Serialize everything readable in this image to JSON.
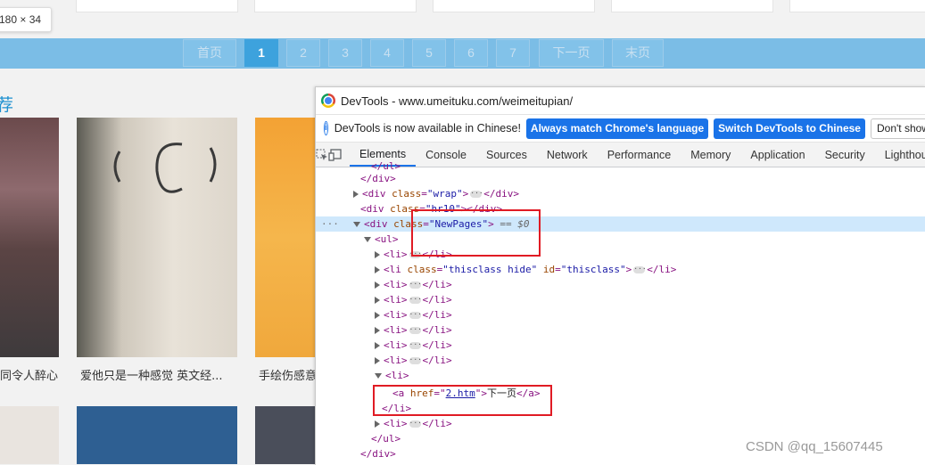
{
  "page": {
    "size_tooltip": "180 × 34",
    "pagination": {
      "pages": [
        "首页",
        "1",
        "2",
        "3",
        "4",
        "5",
        "6",
        "7",
        "下一页",
        "末页"
      ],
      "active": "1"
    },
    "section_title": "荐",
    "cards": [
      {
        "caption": "同令人醉心"
      },
      {
        "caption": "爱他只是一种感觉 英文经..."
      },
      {
        "caption": "手绘伤感意"
      }
    ]
  },
  "devtools": {
    "title": "DevTools - www.umeituku.com/weimeitupian/",
    "info": {
      "message": "DevTools is now available in Chinese!",
      "btn_match": "Always match Chrome's language",
      "btn_switch": "Switch DevTools to Chinese",
      "btn_dismiss": "Don't show again"
    },
    "tabs": [
      "Elements",
      "Console",
      "Sources",
      "Network",
      "Performance",
      "Memory",
      "Application",
      "Security",
      "Lighthouse"
    ],
    "selected_tab": "Elements",
    "dom": {
      "close_ul": "</ul>",
      "close_div": "</div>",
      "div": "div",
      "class_attr": "class",
      "wrap_val": "\"wrap\"",
      "hr10_val": "\"hr10\"",
      "newpages_val": "\"NewPages\"",
      "eq_marker": "== $0",
      "ul_open": "<ul>",
      "li_open": "<li>",
      "li_close": "</li>",
      "thisclass_val": "\"thisclass hide\"",
      "id_attr": "id",
      "thisclass_id": "\"thisclass\"",
      "a_open": "<a",
      "href_attr": "href",
      "href_val": "2.htm",
      "next_text": "下一页",
      "a_close": "</a>"
    }
  },
  "watermark": "CSDN @qq_15607445",
  "colors": {
    "pager_bar": "#7bbde6",
    "pager_active": "#3da2dd",
    "highlight_row": "#cfe8fc",
    "annotation_red": "#e01b24",
    "devtools_blue": "#1a73e8"
  }
}
